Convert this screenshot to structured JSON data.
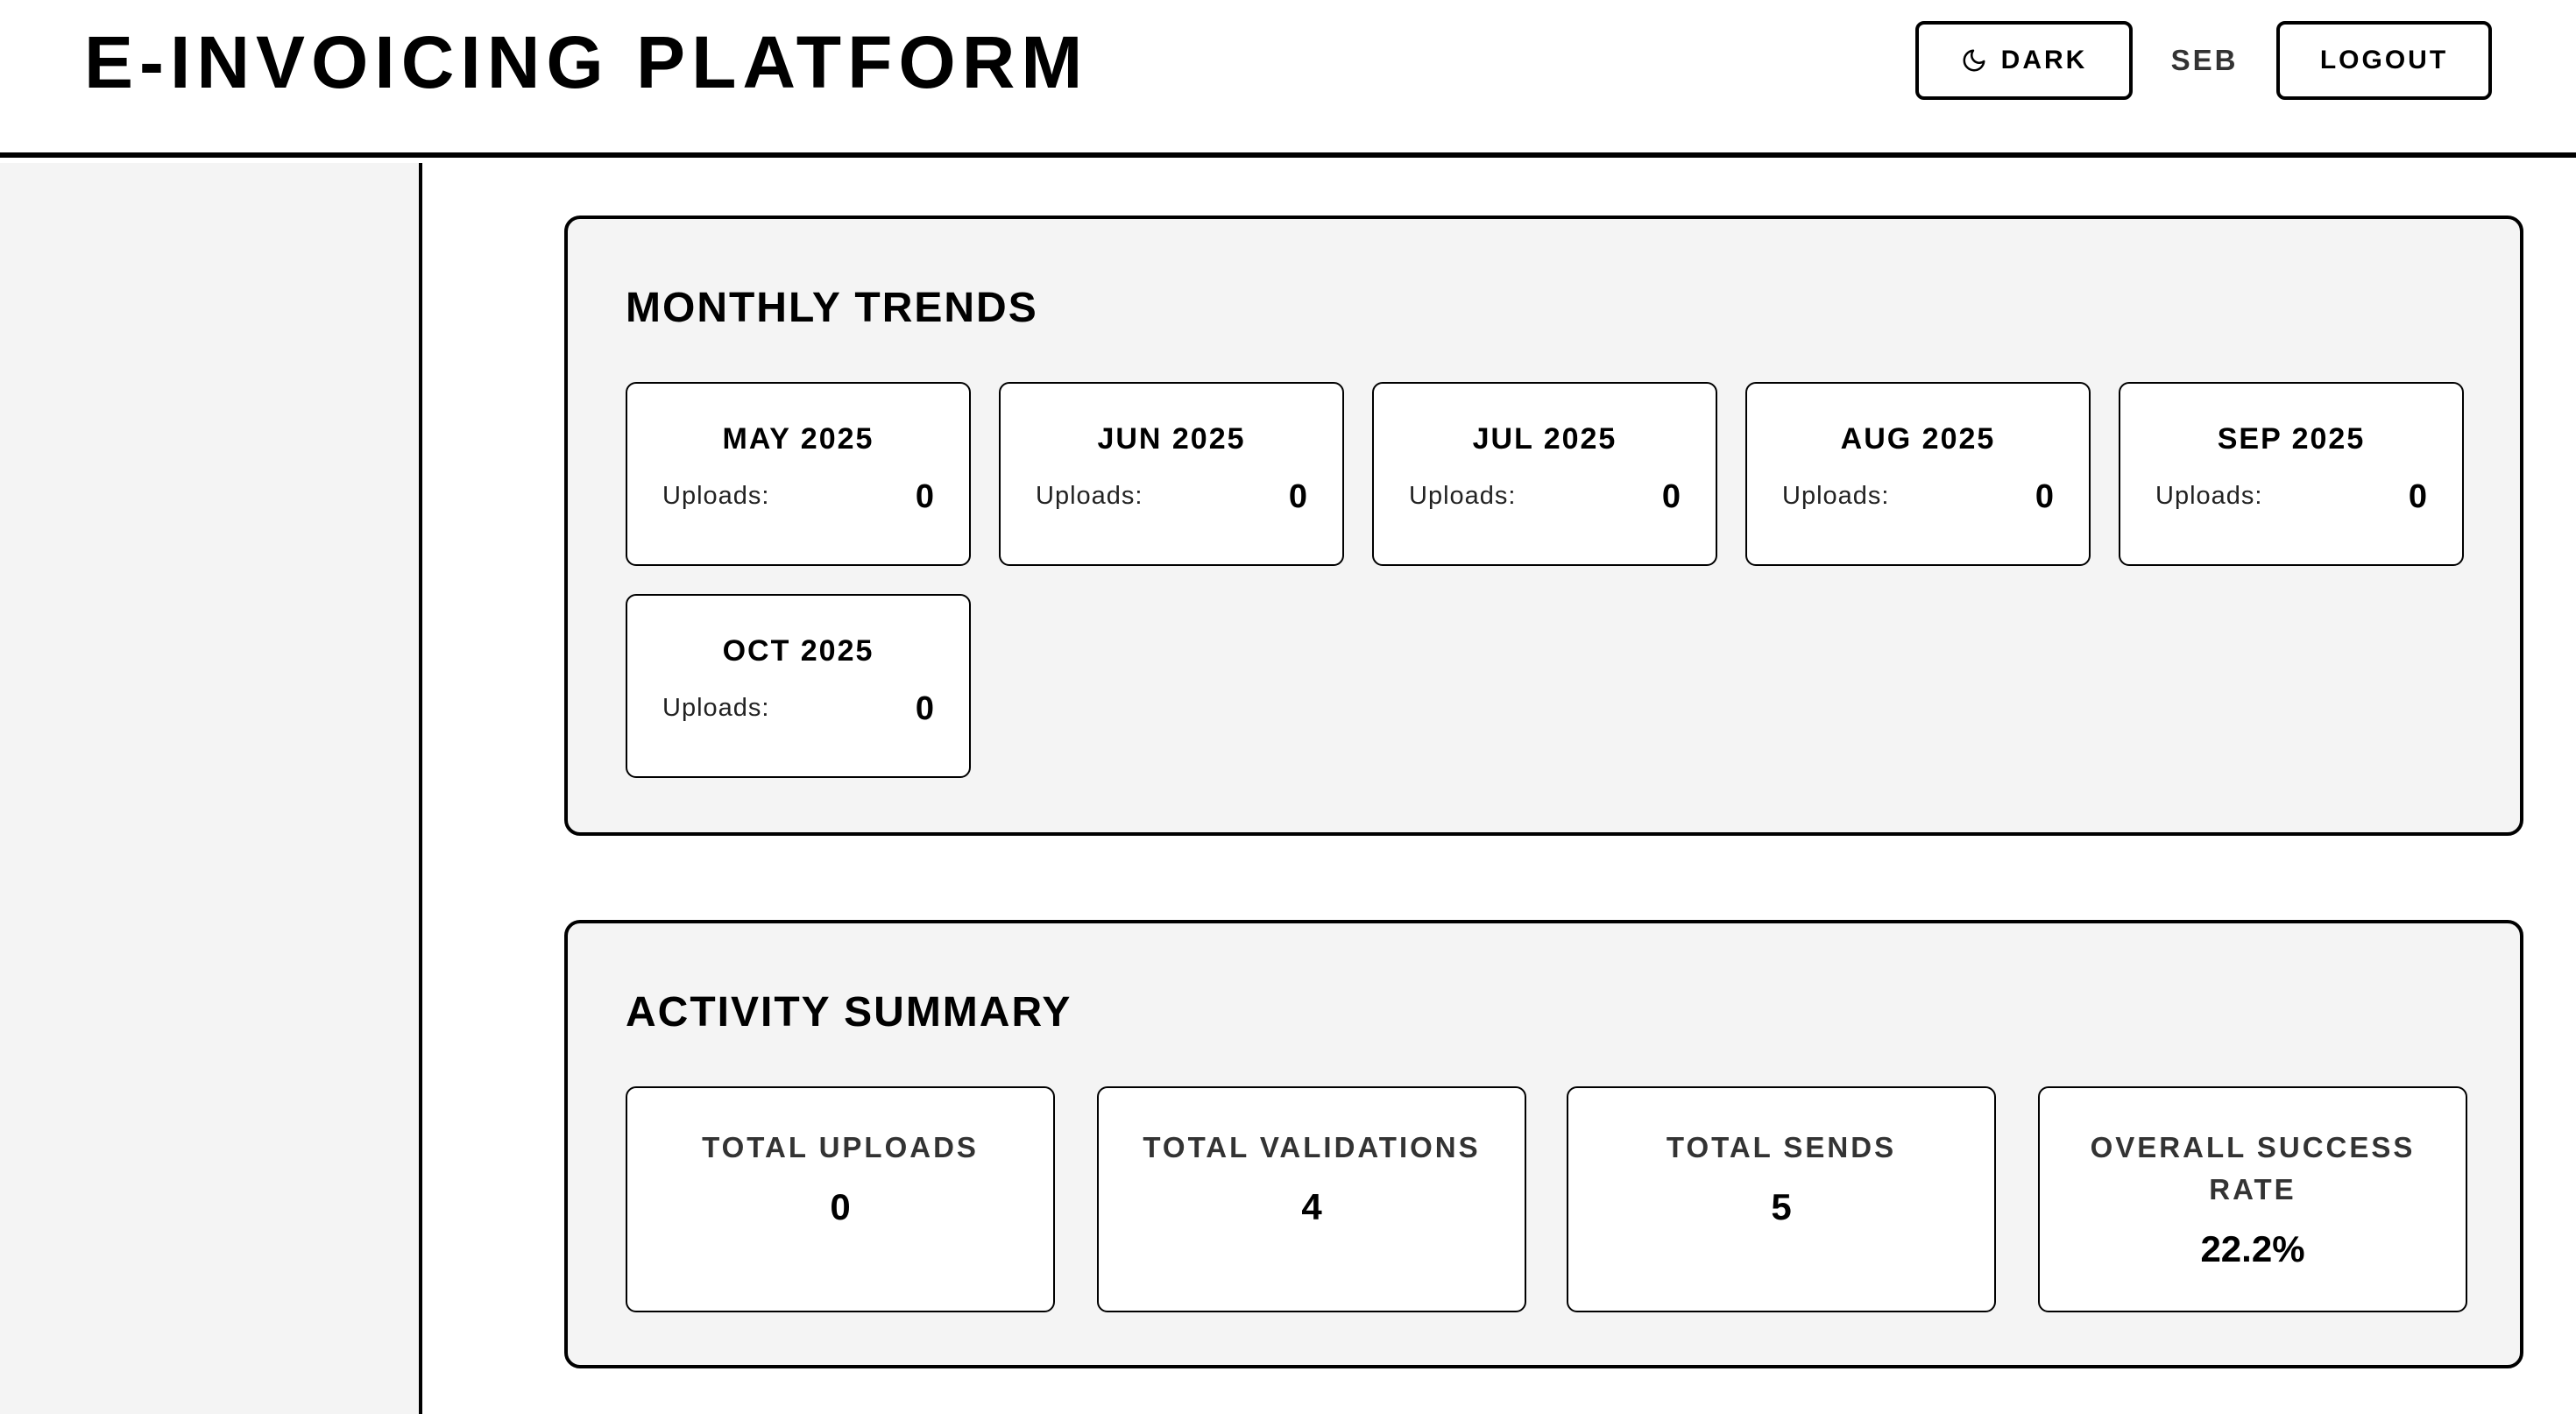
{
  "header": {
    "title": "E-INVOICING PLATFORM",
    "dark_label": "DARK",
    "user": "SEB",
    "logout_label": "LOGOUT"
  },
  "monthly_trends": {
    "title": "MONTHLY TRENDS",
    "months": [
      {
        "name": "MAY 2025",
        "label": "Uploads:",
        "value": "0"
      },
      {
        "name": "JUN 2025",
        "label": "Uploads:",
        "value": "0"
      },
      {
        "name": "JUL 2025",
        "label": "Uploads:",
        "value": "0"
      },
      {
        "name": "AUG 2025",
        "label": "Uploads:",
        "value": "0"
      },
      {
        "name": "SEP 2025",
        "label": "Uploads:",
        "value": "0"
      },
      {
        "name": "OCT 2025",
        "label": "Uploads:",
        "value": "0"
      }
    ]
  },
  "activity_summary": {
    "title": "ACTIVITY SUMMARY",
    "stats": [
      {
        "label": "TOTAL UPLOADS",
        "value": "0"
      },
      {
        "label": "TOTAL VALIDATIONS",
        "value": "4"
      },
      {
        "label": "TOTAL SENDS",
        "value": "5"
      },
      {
        "label": "OVERALL SUCCESS RATE",
        "value": "22.2%"
      }
    ]
  },
  "icons": {
    "theme_toggle": "moon-icon"
  },
  "colors": {
    "border": "#000000",
    "panel_background": "#f4f4f4",
    "card_background": "#ffffff"
  }
}
